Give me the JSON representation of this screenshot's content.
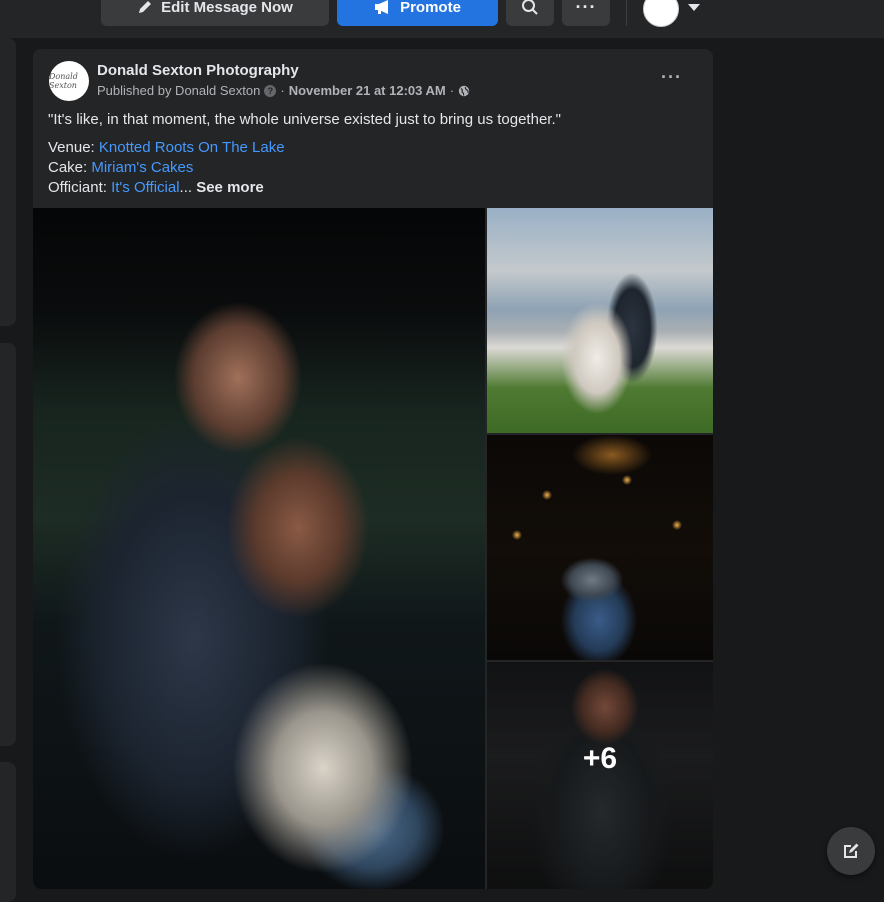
{
  "toolbar": {
    "edit_message_label": "Edit Message Now",
    "promote_label": "Promote",
    "more_label": "···",
    "accent": "#2374e1"
  },
  "post": {
    "page_name": "Donald Sexton Photography",
    "avatar_text": "Donald Sexton",
    "published_by": "Published by Donald Sexton",
    "date": "November 21 at 12:03 AM",
    "separator": "·",
    "more_label": "···",
    "quote": "\"It's like, in that moment, the whole universe existed just to bring us together.\"",
    "venue_label": "Venue: ",
    "venue_link": "Knotted Roots On The Lake",
    "cake_label": "Cake: ",
    "cake_link": "Miriam's Cakes",
    "officiant_label": "Officiant: ",
    "officiant_link": "It's Official",
    "ellipsis": "...",
    "see_more": " See more",
    "more_photos": "+6",
    "link_color": "#4599ff"
  },
  "icons": {
    "edit": "pencil-icon",
    "promote": "megaphone-icon",
    "search": "search-icon",
    "globe": "globe-icon",
    "info": "question-icon",
    "compose": "compose-icon"
  }
}
